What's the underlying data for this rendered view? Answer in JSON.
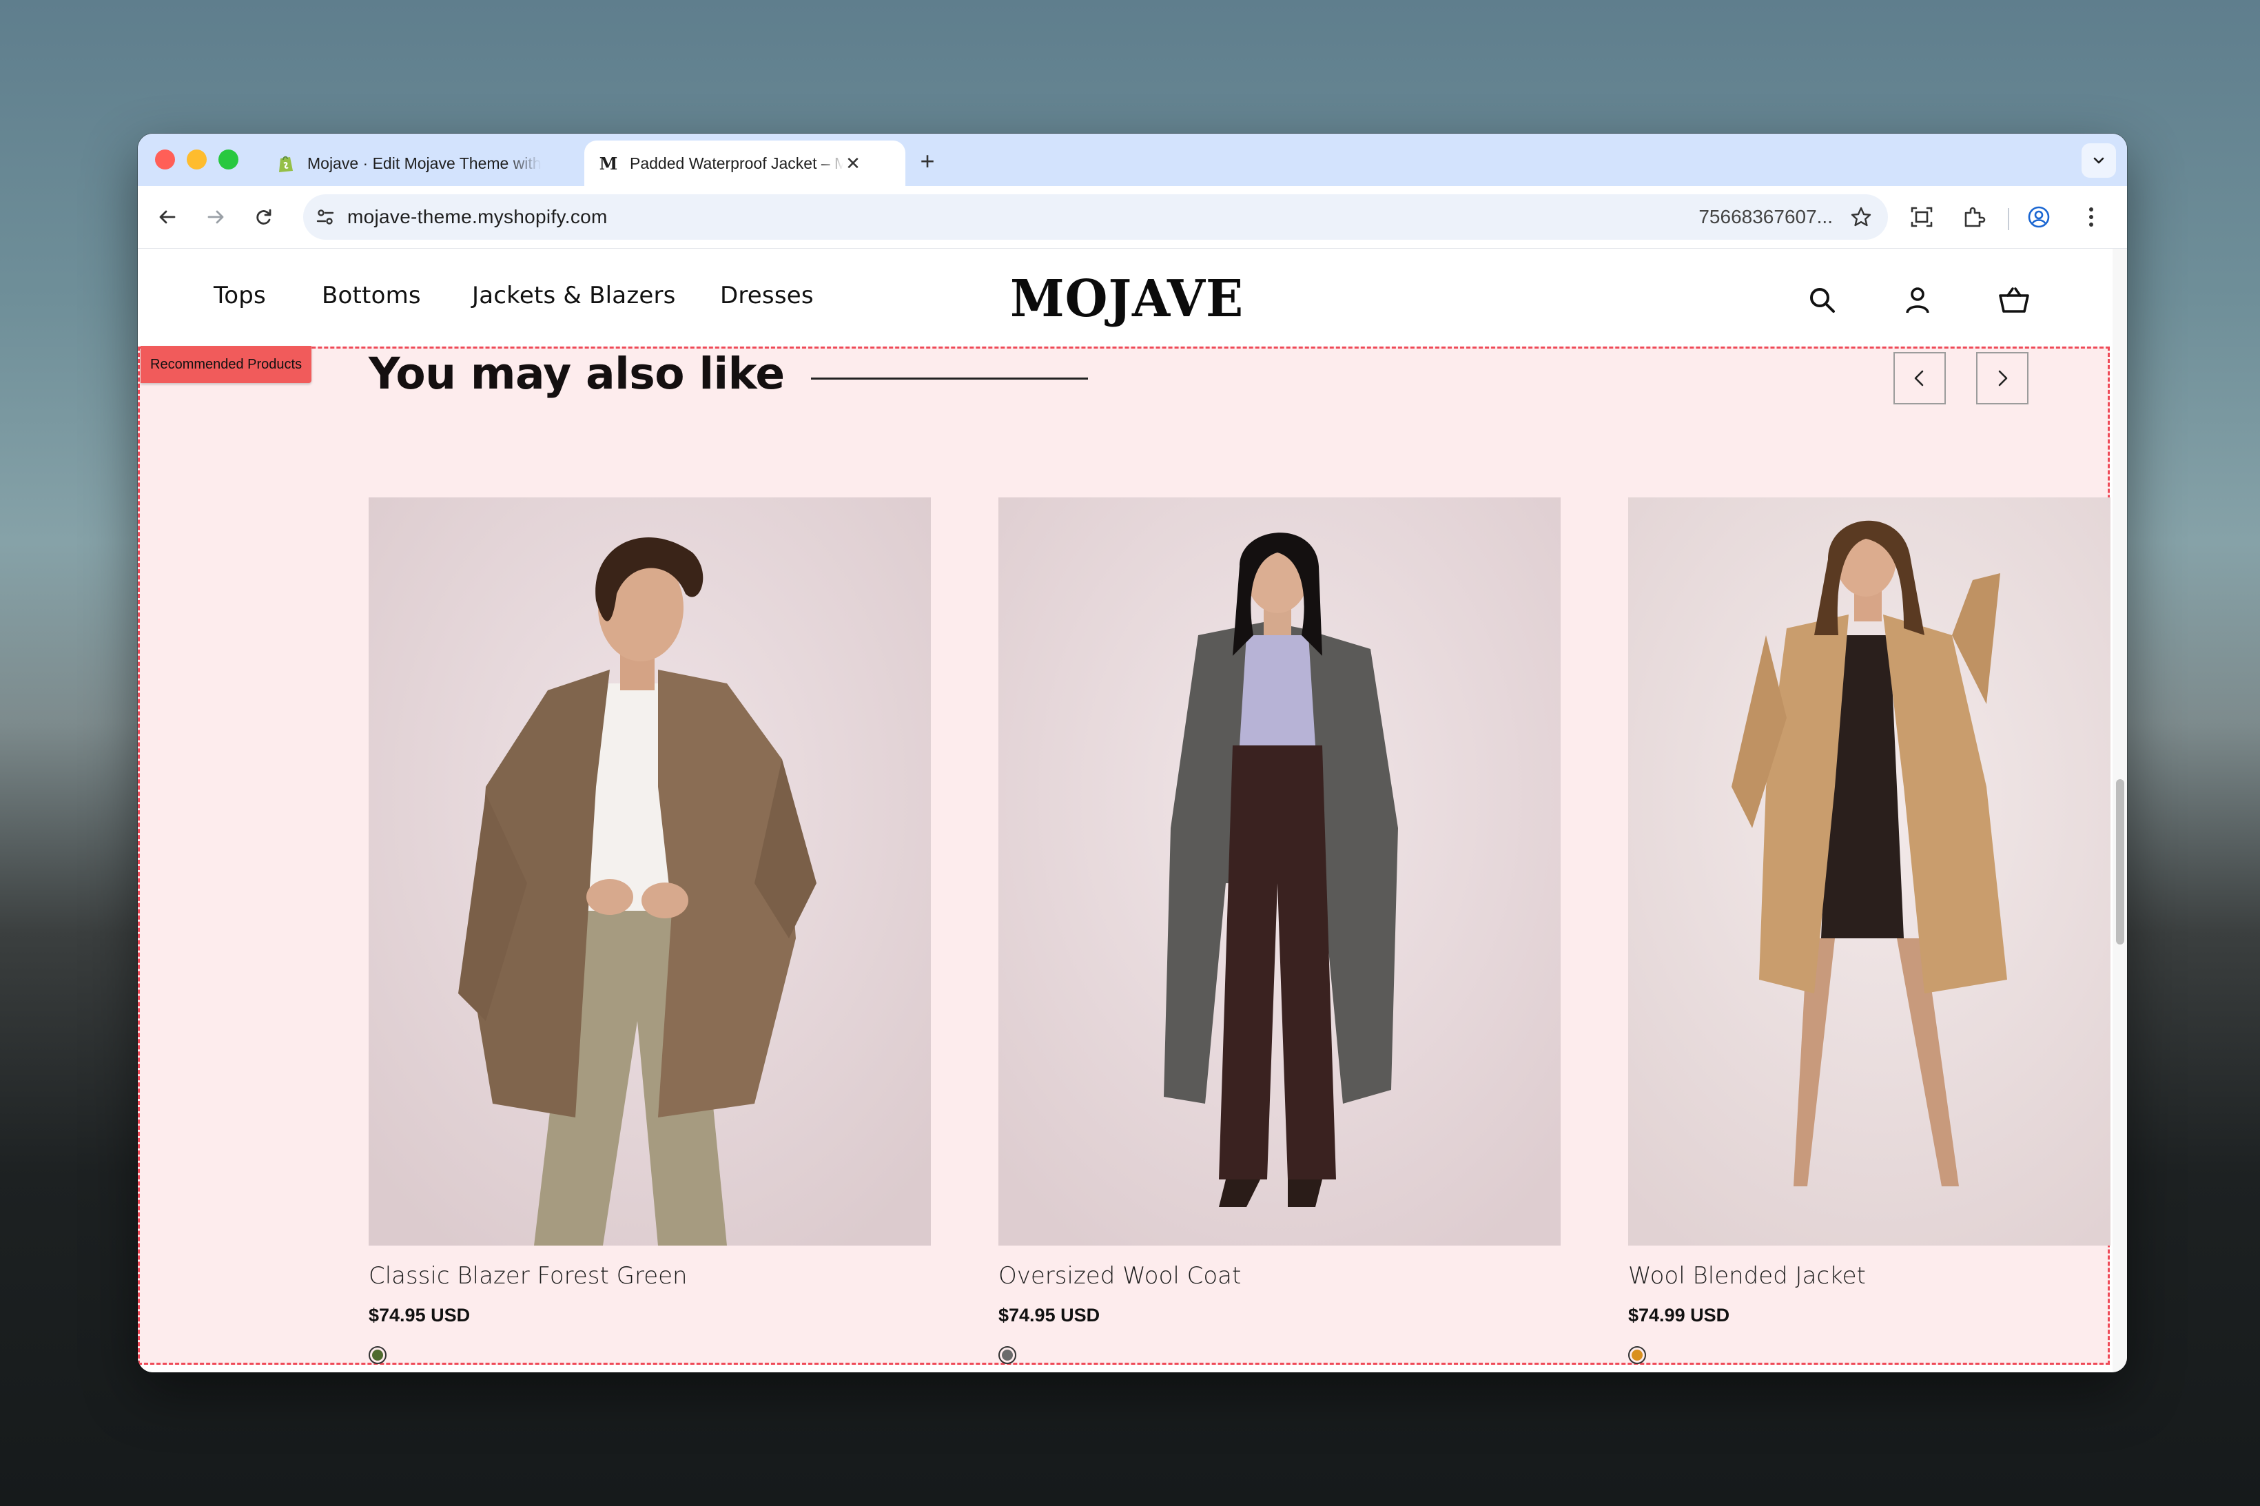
{
  "browser": {
    "tabs": [
      {
        "title": "Mojave · Edit Mojave Theme with",
        "favicon": "shopify-icon",
        "active": false
      },
      {
        "title": "Padded Waterproof Jacket – Mojave",
        "favicon": "mojave-m-icon",
        "active": true
      }
    ],
    "favicon_letter": "M",
    "close_glyph": "✕",
    "new_tab_glyph": "+",
    "url": "mojave-theme.myshopify.com",
    "url_tail": "75668367607..."
  },
  "site": {
    "nav": [
      "Tops",
      "Bottoms",
      "Jackets & Blazers",
      "Dresses"
    ],
    "logo": "MOJAVE",
    "header_icons": [
      "search-icon",
      "account-icon",
      "cart-icon"
    ]
  },
  "section": {
    "badge": "Recommended Products",
    "title": "You may also like",
    "products": [
      {
        "name": "Classic Blazer Forest Green",
        "price": "$74.95 USD",
        "swatch": "#4f6b2f"
      },
      {
        "name": "Oversized Wool Coat",
        "price": "$74.95 USD",
        "swatch": "#6b6b6b"
      },
      {
        "name": "Wool Blended Jacket",
        "price": "$74.99 USD",
        "swatch": "#d9901e"
      }
    ]
  },
  "colors": {
    "tab_strip": "#d3e3fd",
    "section_bg": "#fdeced",
    "section_outline": "#ef4a58",
    "badge_bg": "#f15b5b"
  }
}
